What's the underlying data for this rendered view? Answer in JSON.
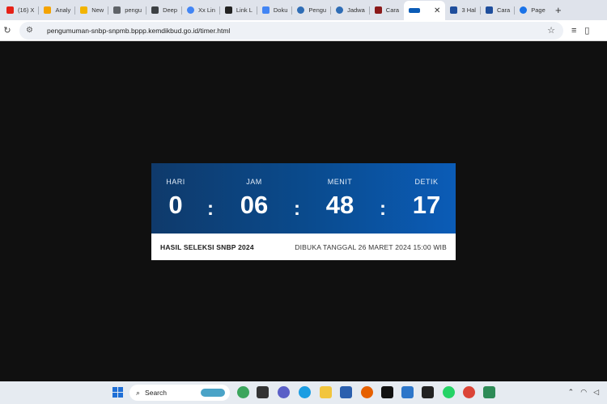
{
  "browser": {
    "tabs": [
      {
        "label": "(16) X",
        "icon": "youtube-icon",
        "color": "#e62117"
      },
      {
        "label": "Analy",
        "icon": "analytics-icon",
        "color": "#f4a300"
      },
      {
        "label": "New",
        "icon": "pencil-icon",
        "color": "#f2b400"
      },
      {
        "label": "pengu",
        "icon": "trend-icon",
        "color": "#5f6368"
      },
      {
        "label": "Deep",
        "icon": "deep-icon",
        "color": "#3c4043"
      },
      {
        "label": "Xx Lin",
        "icon": "google-icon",
        "color": "#4285f4"
      },
      {
        "label": "Link L",
        "icon": "k-icon",
        "color": "#222222"
      },
      {
        "label": "Doku",
        "icon": "docs-icon",
        "color": "#4285f4"
      },
      {
        "label": "Pengu",
        "icon": "globe-icon",
        "color": "#2f6db5"
      },
      {
        "label": "Jadwa",
        "icon": "globe-icon",
        "color": "#2f6db5"
      },
      {
        "label": "Cara",
        "icon": "site-icon",
        "color": "#8b1a1a"
      },
      {
        "label": "3 Hal",
        "icon": "play-icon",
        "color": "#1f4e9c"
      },
      {
        "label": "Cara",
        "icon": "play-icon",
        "color": "#1f4e9c"
      },
      {
        "label": "Page",
        "icon": "info-icon",
        "color": "#1a73e8"
      }
    ],
    "active_tab": {
      "icon": "snbp-icon",
      "close": "✕"
    },
    "new_tab": "+",
    "url": "pengumuman-snbp-snpmb.bppp.kemdikbud.go.id/timer.html"
  },
  "timer": {
    "units": [
      {
        "label": "HARI",
        "value": "0"
      },
      {
        "label": "JAM",
        "value": "06"
      },
      {
        "label": "MENIT",
        "value": "48"
      },
      {
        "label": "DETIK",
        "value": "17"
      }
    ],
    "separator": ":",
    "title": "HASIL SELEKSI SNBP 2024",
    "open_date": "DIBUKA TANGGAL 26 MARET 2024 15:00 WIB"
  },
  "taskbar": {
    "search_label": "Search"
  }
}
